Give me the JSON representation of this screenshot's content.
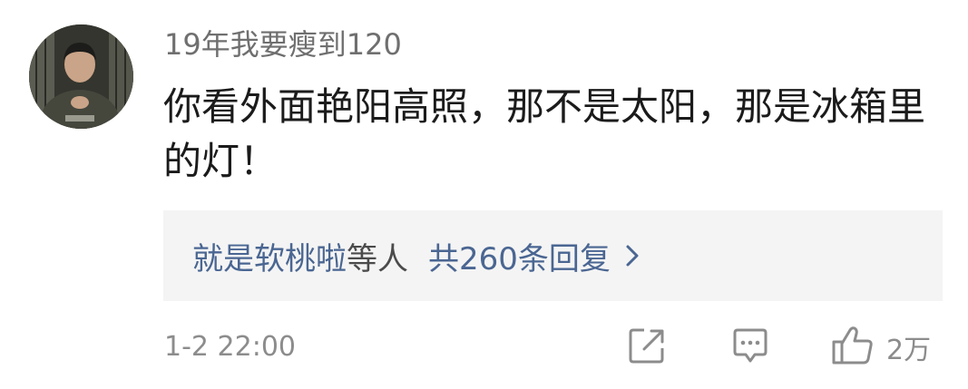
{
  "comment": {
    "username": "19年我要瘦到120",
    "text": "你看外面艳阳高照，那不是太阳，那是冰箱里的灯！",
    "replies": {
      "user": "就是软桃啦",
      "suffix": "等人",
      "count_text": "共260条回复"
    },
    "timestamp": "1-2 22:00",
    "like_count": "2万"
  },
  "icons": {
    "avatar": "user-avatar",
    "share": "share-icon",
    "reply": "comment-icon",
    "like": "thumbs-up-icon",
    "chevron": "chevron-right-icon"
  },
  "colors": {
    "link": "#4a6692",
    "muted": "#8c8c8c",
    "reply_bg": "#f4f4f4"
  }
}
